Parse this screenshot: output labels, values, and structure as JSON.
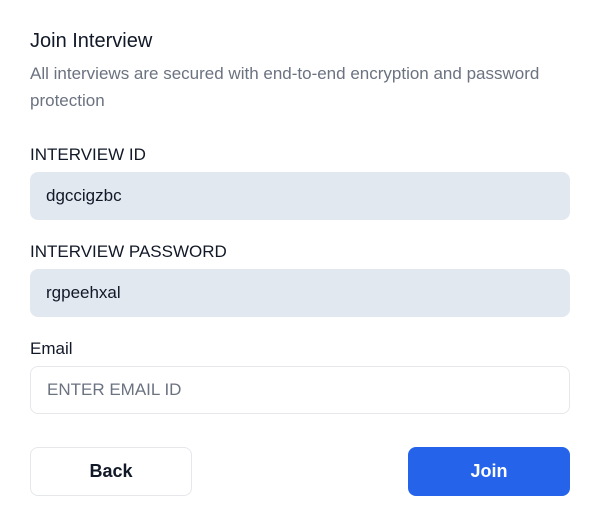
{
  "title": "Join Interview",
  "subtitle": "All interviews are secured with end-to-end encryption and password protection",
  "fields": {
    "id_label": "INTERVIEW ID",
    "id_value": "dgccigzbc",
    "password_label": "INTERVIEW PASSWORD",
    "password_value": "rgpeehxal",
    "email_label": "Email",
    "email_placeholder": "ENTER EMAIL ID"
  },
  "buttons": {
    "back": "Back",
    "join": "Join"
  }
}
